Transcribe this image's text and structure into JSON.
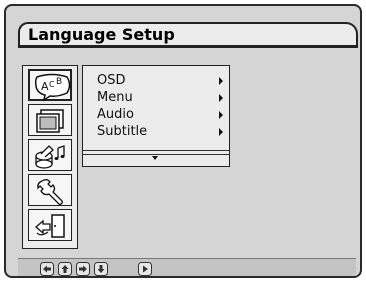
{
  "window": {
    "title": "Language Setup"
  },
  "sidebar": {
    "items": [
      {
        "id": "language",
        "icon": "language-abc-icon",
        "selected": true
      },
      {
        "id": "display",
        "icon": "display-screens-icon",
        "selected": false
      },
      {
        "id": "audio",
        "icon": "speaker-music-icon",
        "selected": false
      },
      {
        "id": "system",
        "icon": "wrench-icon",
        "selected": false
      },
      {
        "id": "exit",
        "icon": "exit-door-icon",
        "selected": false
      }
    ]
  },
  "submenu": {
    "items": [
      {
        "label": "OSD"
      },
      {
        "label": "Menu"
      },
      {
        "label": "Audio"
      },
      {
        "label": "Subtitle"
      }
    ],
    "more_indicator": "down-triangle-icon"
  },
  "bottom_bar": {
    "buttons": [
      "left-arrow-icon",
      "up-arrow-icon",
      "right-arrow-icon",
      "down-arrow-icon",
      "play-icon"
    ]
  },
  "colors": {
    "panel_bg": "#d5d5d5",
    "menu_bg": "#ececec",
    "border": "#222222"
  }
}
